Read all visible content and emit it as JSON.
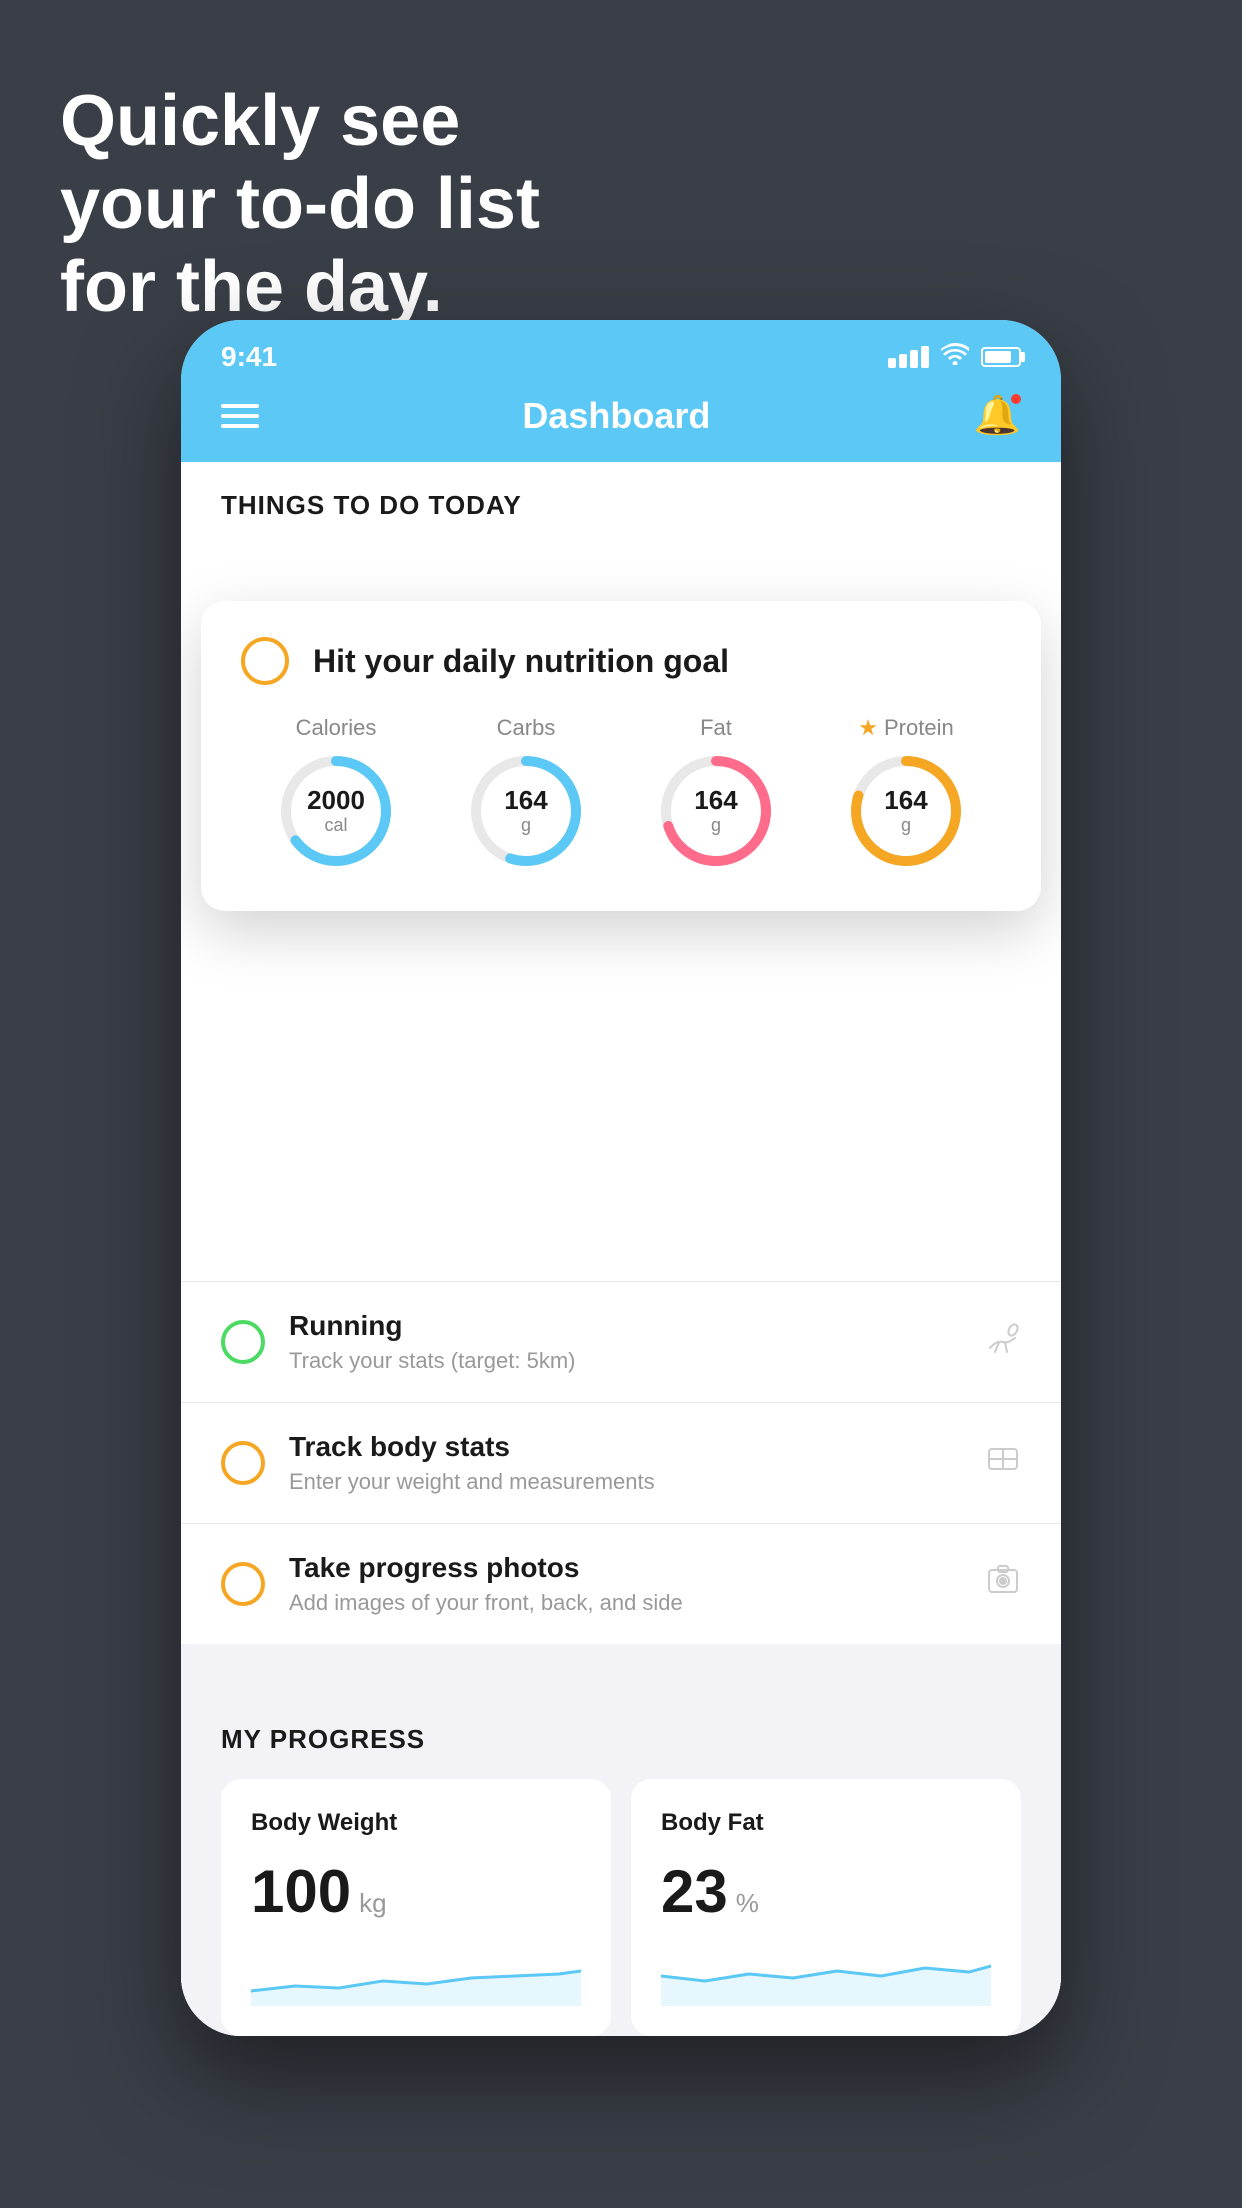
{
  "hero": {
    "line1": "Quickly see",
    "line2": "your to-do list",
    "line3": "for the day."
  },
  "status_bar": {
    "time": "9:41"
  },
  "nav": {
    "title": "Dashboard"
  },
  "things_section": {
    "title": "THINGS TO DO TODAY"
  },
  "floating_card": {
    "title": "Hit your daily nutrition goal",
    "nutrition": [
      {
        "label": "Calories",
        "value": "2000",
        "unit": "cal",
        "color": "#5bc8f5",
        "percent": 65,
        "starred": false
      },
      {
        "label": "Carbs",
        "value": "164",
        "unit": "g",
        "color": "#5bc8f5",
        "percent": 55,
        "starred": false
      },
      {
        "label": "Fat",
        "value": "164",
        "unit": "g",
        "color": "#ff6b8a",
        "percent": 70,
        "starred": false
      },
      {
        "label": "Protein",
        "value": "164",
        "unit": "g",
        "color": "#f5a623",
        "percent": 80,
        "starred": true
      }
    ]
  },
  "todo_items": [
    {
      "title": "Running",
      "subtitle": "Track your stats (target: 5km)",
      "circle_color": "green",
      "icon": "👟"
    },
    {
      "title": "Track body stats",
      "subtitle": "Enter your weight and measurements",
      "circle_color": "yellow",
      "icon": "⚖"
    },
    {
      "title": "Take progress photos",
      "subtitle": "Add images of your front, back, and side",
      "circle_color": "yellow",
      "icon": "👤"
    }
  ],
  "progress": {
    "section_title": "MY PROGRESS",
    "cards": [
      {
        "title": "Body Weight",
        "value": "100",
        "unit": "kg"
      },
      {
        "title": "Body Fat",
        "value": "23",
        "unit": "%"
      }
    ]
  }
}
